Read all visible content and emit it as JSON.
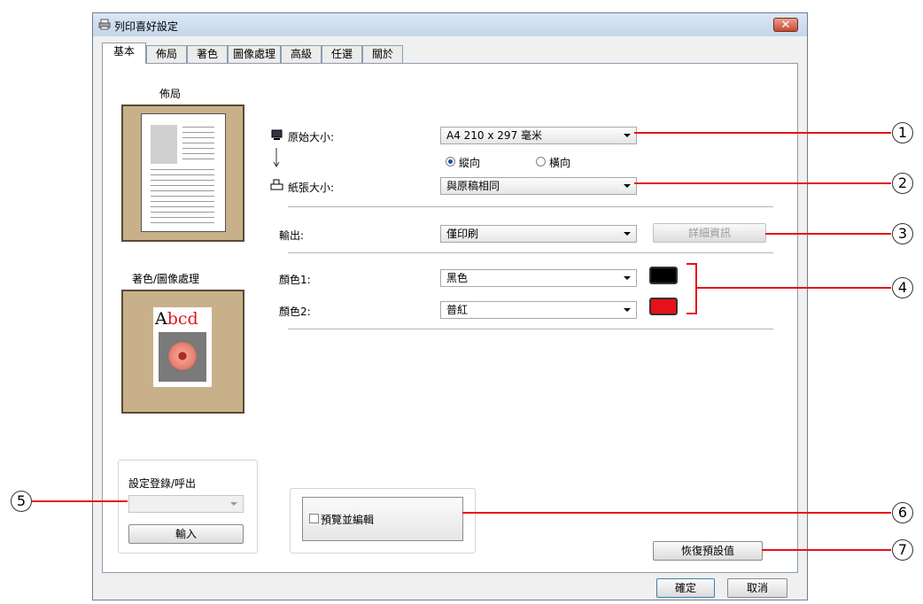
{
  "window": {
    "title": "列印喜好設定",
    "close_label": "✕"
  },
  "tabs": [
    {
      "label": "基本"
    },
    {
      "label": "佈局"
    },
    {
      "label": "著色"
    },
    {
      "label": "圖像處理"
    },
    {
      "label": "高級"
    },
    {
      "label": "任選"
    },
    {
      "label": "關於"
    }
  ],
  "preview": {
    "layout_label": "佈局",
    "color_label": "著色/圖像處理",
    "sample_text_a": "A",
    "sample_text_bcd": "bcd"
  },
  "fields": {
    "original_size": {
      "label": "原始大小:",
      "value": "A4 210 x 297 毫米"
    },
    "orientation": {
      "portrait": "縱向",
      "landscape": "橫向",
      "selected": "portrait"
    },
    "paper_size": {
      "label": "紙張大小:",
      "value": "與原稿相同"
    },
    "output": {
      "label": "輸出:",
      "value": "僅印刷",
      "details_button": "詳細資訊"
    },
    "color1": {
      "label": "顏色1:",
      "value": "黑色",
      "swatch": "#000000"
    },
    "color2": {
      "label": "顏色2:",
      "value": "普紅",
      "swatch": "#e8101a"
    }
  },
  "settings_group": {
    "title": "設定登錄/呼出",
    "select_value": "",
    "input_button": "輸入"
  },
  "preview_edit": {
    "label": "預覽並編輯",
    "checked": false
  },
  "restore_button": "恢復預設值",
  "footer": {
    "ok": "確定",
    "cancel": "取消"
  },
  "callouts": [
    "1",
    "2",
    "3",
    "4",
    "5",
    "6",
    "7"
  ],
  "colors": {
    "accent_red": "#e8101a",
    "beige": "#c8b08a"
  }
}
